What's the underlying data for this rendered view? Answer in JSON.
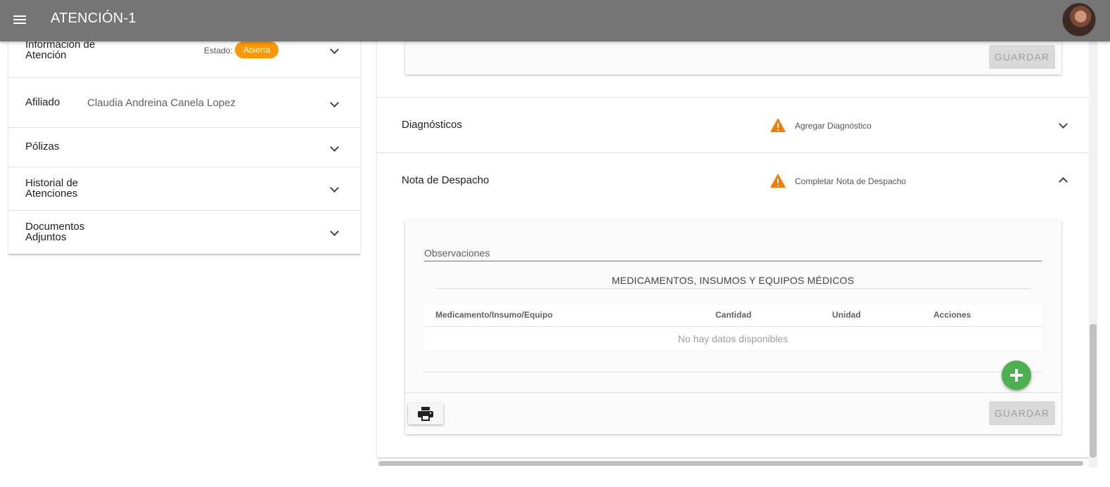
{
  "app": {
    "title": "ATENCIÓN-1",
    "menu_icon": "menu-icon",
    "avatar_icon": "user-avatar"
  },
  "left_panel": {
    "info": {
      "label_line1": "Información de",
      "label_line2": "Atención",
      "estado_label": "Estado:",
      "estado_value": "Abierta",
      "estado_color": "#ff9800"
    },
    "afiliado": {
      "label": "Afiliado",
      "value": "Claudia Andreina Canela Lopez"
    },
    "polizas": {
      "label": "Pólizas"
    },
    "historial": {
      "label_line1": "Historial de",
      "label_line2": "Atenciones"
    },
    "documentos": {
      "label_line1": "Documentos",
      "label_line2": "Adjuntos"
    }
  },
  "right_panel": {
    "top_card": {
      "save_label": "GUARDAR"
    },
    "diagnosticos": {
      "title": "Diagnósticos",
      "warning_text": "Agregar Diagnóstico",
      "warning_color": "#f57c00"
    },
    "nota_despacho": {
      "title": "Nota de Despacho",
      "warning_text": "Completar Nota de Despacho",
      "observaciones_label": "Observaciones",
      "section_title": "MEDICAMENTOS, INSUMOS Y EQUIPOS MÉDICOS",
      "table": {
        "headers": [
          "Medicamento/Insumo/Equipo",
          "Cantidad",
          "Unidad",
          "Acciones"
        ],
        "empty_text": "No hay datos disponibles"
      },
      "add_button_color": "#4caf50",
      "print_icon": "printer-icon",
      "save_label": "GUARDAR"
    }
  }
}
